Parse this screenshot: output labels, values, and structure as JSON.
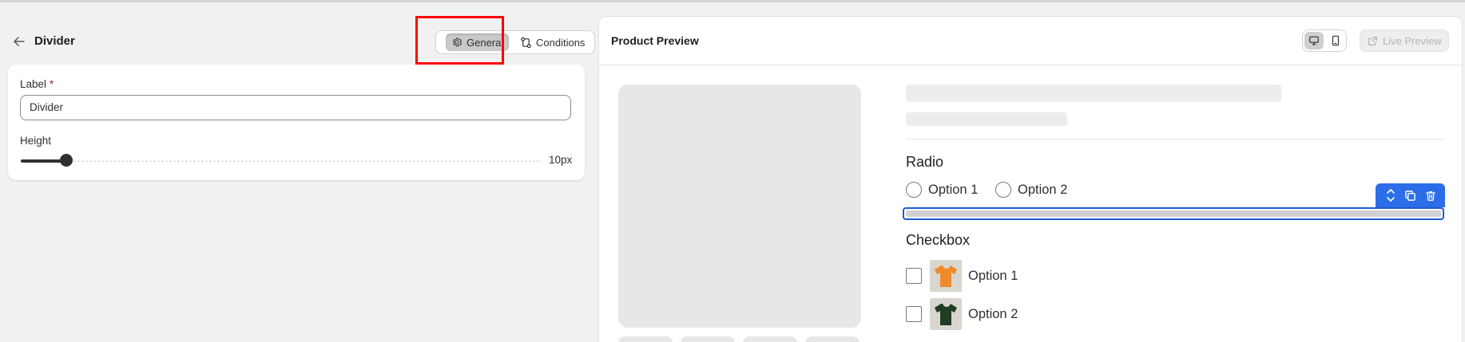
{
  "editor": {
    "title": "Divider",
    "tabs": [
      {
        "label": "General",
        "icon": "gear-icon",
        "active": true
      },
      {
        "label": "Conditions",
        "icon": "flow-icon",
        "active": false
      }
    ],
    "fields": {
      "label_title": "Label",
      "label_required": "*",
      "label_value": "Divider",
      "height_title": "Height",
      "height_value": "10px",
      "height_fraction": 0.087
    }
  },
  "preview": {
    "title": "Product Preview",
    "live_preview_label": "Live Preview",
    "radio": {
      "title": "Radio",
      "options": [
        "Option 1",
        "Option 2"
      ]
    },
    "checkbox": {
      "title": "Checkbox",
      "options": [
        {
          "label": "Option 1",
          "color": "#ef8a2a"
        },
        {
          "label": "Option 2",
          "color": "#1f3e22"
        }
      ]
    }
  },
  "colors": {
    "selection": "#1f5bd1",
    "toolbar": "#2c6ee8",
    "highlight": "#ff0000"
  }
}
